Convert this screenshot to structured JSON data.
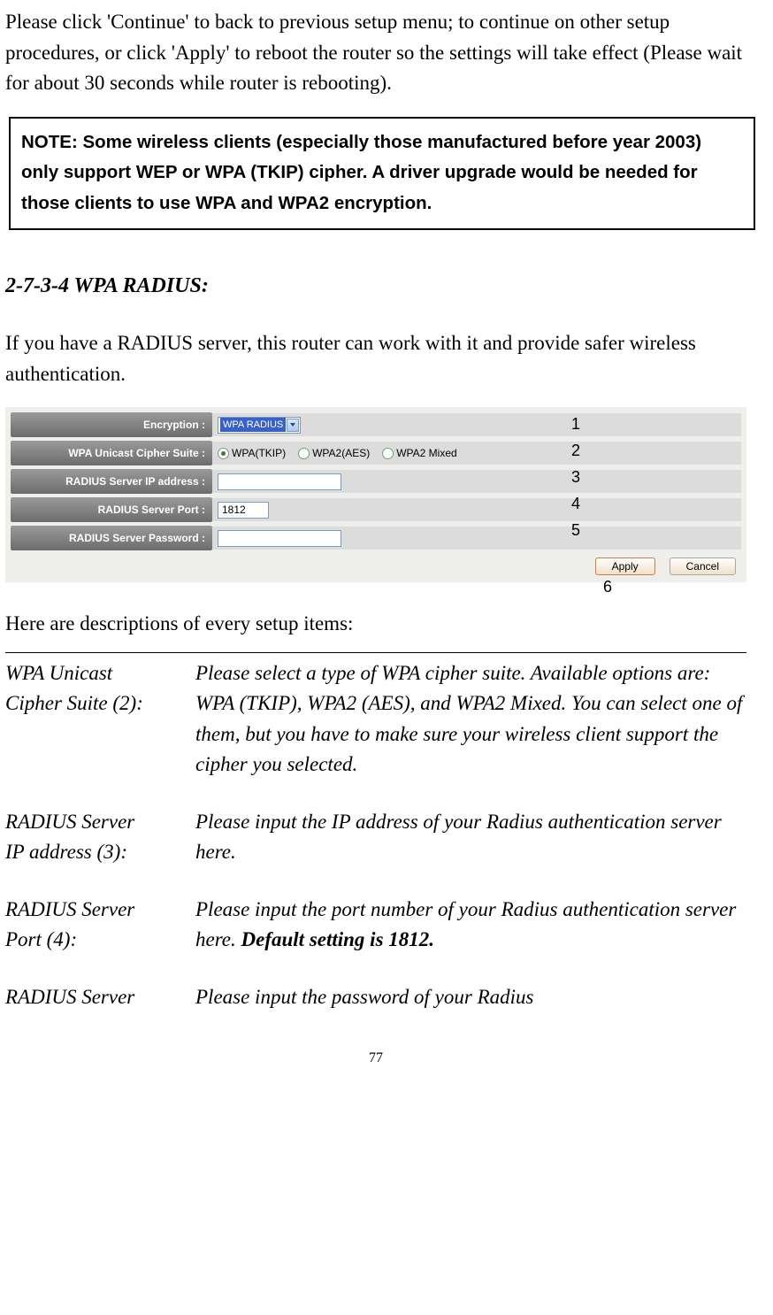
{
  "intro": "Please click 'Continue' to back to previous setup menu; to continue on other setup procedures, or click 'Apply' to reboot the router so the settings will take effect (Please wait for about 30 seconds while router is rebooting).",
  "note": "NOTE: Some wireless clients (especially those manufactured before year 2003) only support WEP or WPA (TKIP) cipher. A driver upgrade would be needed for those clients to use WPA and WPA2 encryption.",
  "section_heading": "2-7-3-4 WPA RADIUS:",
  "section_intro": "If you have a RADIUS server, this router can work with it and provide safer wireless authentication.",
  "form": {
    "encryption_label": "Encryption :",
    "encryption_value": "WPA RADIUS",
    "cipher_label": "WPA Unicast Cipher Suite :",
    "cipher_options": [
      "WPA(TKIP)",
      "WPA2(AES)",
      "WPA2 Mixed"
    ],
    "cipher_selected_index": 0,
    "ip_label": "RADIUS Server IP address :",
    "ip_value": "",
    "port_label": "RADIUS Server Port :",
    "port_value": "1812",
    "password_label": "RADIUS Server Password :",
    "password_value": "",
    "apply_btn": "Apply",
    "cancel_btn": "Cancel"
  },
  "annotations": [
    "1",
    "2",
    "3",
    "4",
    "5",
    "6"
  ],
  "desc_intro": "Here are descriptions of every setup items:",
  "descriptions": [
    {
      "term1": "WPA Unicast",
      "term2": "Cipher Suite (2):",
      "def": "Please select a type of WPA cipher suite. Available options are: WPA (TKIP), WPA2 (AES), and WPA2 Mixed. You can select one of them, but you have to make sure your wireless client support the cipher you selected."
    },
    {
      "term1": "RADIUS Server",
      "term2": "IP address (3):",
      "def": "Please input the IP address of your Radius authentication server here."
    },
    {
      "term1": "RADIUS Server",
      "term2": "Port (4):",
      "def_pre": "Please input the port number of your Radius authentication server here. ",
      "def_strong": "Default setting is 1812."
    },
    {
      "term1": "RADIUS Server",
      "term2": "",
      "def": "Please input the password of your Radius"
    }
  ],
  "page_number": "77"
}
